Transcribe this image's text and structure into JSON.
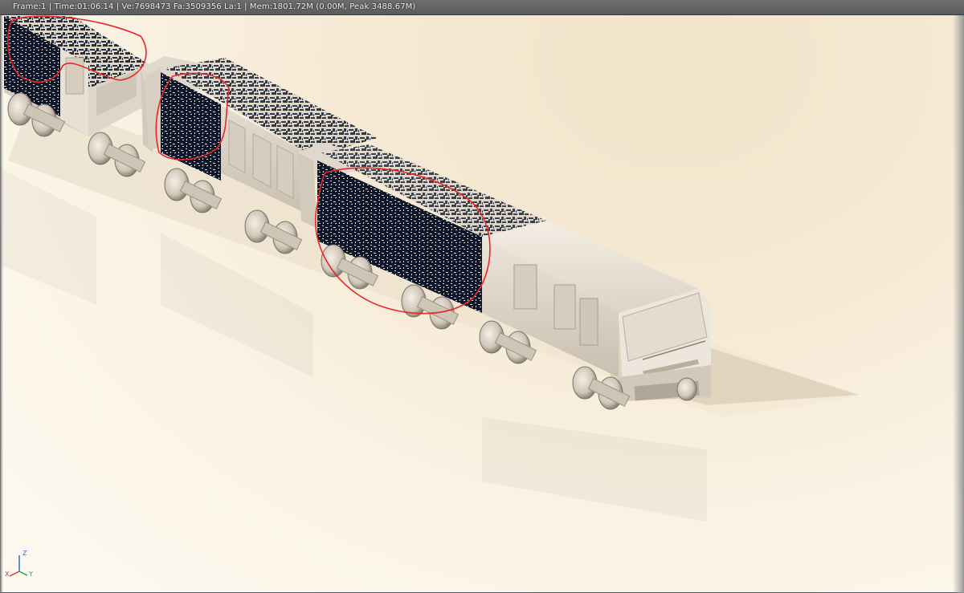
{
  "viewport": {
    "stats_text": "Frame:1 | Time:01:06.14 | Ve:7698473 Fa:3509356 La:1 | Mem:1801.72M (0.00M, Peak 3488.67M)",
    "background_color": "#f6ead5",
    "annotation_color": "#e8262a"
  },
  "scene": {
    "subject": "subway-train-render",
    "cars": 3,
    "annotation_circles": 3
  },
  "axis_gizmo": {
    "z_label": "Z",
    "x_label": "X",
    "y_label": "Y",
    "z_color": "#2f6fd6",
    "x_color": "#d23a3a",
    "y_color": "#2e9e3e"
  }
}
